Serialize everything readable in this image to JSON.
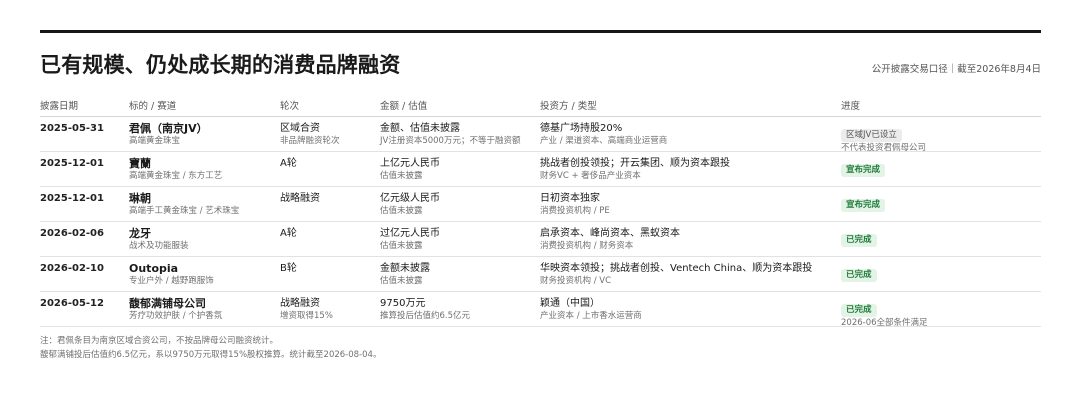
{
  "title": "已有规模、仍处成长期的消费品牌融资",
  "meta": "公开披露交易口径｜截至2026年8月4日",
  "headers": {
    "date": "披露日期",
    "name": "标的 / 赛道",
    "round": "轮次",
    "amount": "金额 / 估值",
    "investor": "投资方 / 类型",
    "status": "进度"
  },
  "rows": [
    {
      "date": "2025-05-31",
      "name": "君佩（南京JV）",
      "sector": "高端黄金珠宝",
      "round": "区域合资",
      "round_sub": "非品牌融资轮次",
      "amount": "金额、估值未披露",
      "amount_sub": "JV注册资本5000万元；不等于融资额",
      "investor": "德基广场持股20%",
      "investor_type": "产业 / 渠道资本、高端商业运营商",
      "status": "区域JV已设立",
      "status_style": "grey",
      "status_note": "不代表投资君佩母公司"
    },
    {
      "date": "2025-12-01",
      "name": "寶蘭",
      "sector": "高端黄金珠宝 / 东方工艺",
      "round": "A轮",
      "round_sub": "",
      "amount": "上亿元人民币",
      "amount_sub": "估值未披露",
      "investor": "挑战者创投领投；开云集团、顺为资本跟投",
      "investor_type": "财务VC + 奢侈品产业资本",
      "status": "宣布完成",
      "status_style": "green",
      "status_note": ""
    },
    {
      "date": "2025-12-01",
      "name": "琳朝",
      "sector": "高端手工黄金珠宝 / 艺术珠宝",
      "round": "战略融资",
      "round_sub": "",
      "amount": "亿元级人民币",
      "amount_sub": "估值未披露",
      "investor": "日初资本独家",
      "investor_type": "消费投资机构 / PE",
      "status": "宣布完成",
      "status_style": "green",
      "status_note": ""
    },
    {
      "date": "2026-02-06",
      "name": "龙牙",
      "sector": "战术及功能服装",
      "round": "A轮",
      "round_sub": "",
      "amount": "过亿元人民币",
      "amount_sub": "估值未披露",
      "investor": "启承资本、峰尚资本、黑蚁资本",
      "investor_type": "消费投资机构 / 财务资本",
      "status": "已完成",
      "status_style": "green",
      "status_note": ""
    },
    {
      "date": "2026-02-10",
      "name": "Outopia",
      "sector": "专业户外 / 越野跑服饰",
      "round": "B轮",
      "round_sub": "",
      "amount": "金额未披露",
      "amount_sub": "估值未披露",
      "investor": "华映资本领投；挑战者创投、Ventech China、顺为资本跟投",
      "investor_type": "财务投资机构 / VC",
      "status": "已完成",
      "status_style": "green",
      "status_note": ""
    },
    {
      "date": "2026-05-12",
      "name": "馥郁满铺母公司",
      "sector": "芳疗功效护肤 / 个护香氛",
      "round": "战略融资",
      "round_sub": "增资取得15%",
      "amount": "9750万元",
      "amount_sub": "推算投后估值约6.5亿元",
      "investor": "颖通（中国）",
      "investor_type": "产业资本 / 上市香水运营商",
      "status": "已完成",
      "status_style": "green",
      "status_note": "2026-06全部条件满足"
    }
  ],
  "notes": [
    "注：君佩条目为南京区域合资公司，不按品牌母公司融资统计。",
    "馥郁满铺投后估值约6.5亿元，系以9750万元取得15%股权推算。统计截至2026-08-04。"
  ],
  "colors": {
    "badge_green_bg": "#e3f3e6",
    "badge_green_text": "#1f7a3a",
    "badge_grey_bg": "#ececec"
  }
}
